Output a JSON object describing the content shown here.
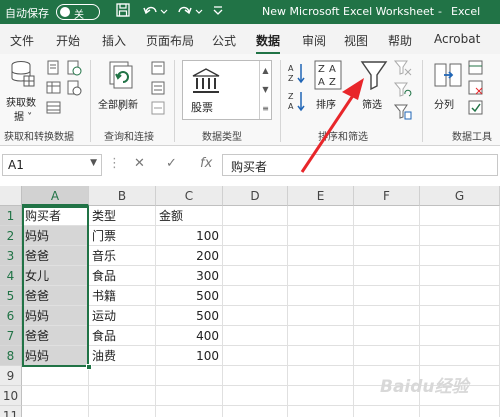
{
  "titlebar": {
    "autosave_label": "自动保存",
    "autosave_state": "关",
    "doc_title": "New Microsoft Excel Worksheet",
    "separator": "-",
    "app_name": "Excel"
  },
  "ribbon_tabs": [
    "文件",
    "开始",
    "插入",
    "页面布局",
    "公式",
    "数据",
    "审阅",
    "视图",
    "帮助",
    "Acrobat"
  ],
  "active_tab": "数据",
  "ribbon": {
    "get_data_label": "获取数\n据",
    "get_data_label_line1": "获取数",
    "get_data_label_line2": "据 ˅",
    "group_get_transform": "获取和转换数据",
    "refresh_all_label": "全部刷新",
    "refresh_all_dd": "˅",
    "group_query": "查询和连接",
    "stock_label": "股票",
    "group_data_types": "数据类型",
    "sort_label": "排序",
    "filter_label": "筛选",
    "group_sort_filter": "排序和筛选",
    "split_label": "分列",
    "group_data_tools": "数据工具"
  },
  "formula_bar": {
    "name_box": "A1",
    "cancel_icon": "✕",
    "enter_icon": "✓",
    "fx_label": "fx",
    "formula": "购买者"
  },
  "grid": {
    "columns": [
      "A",
      "B",
      "C",
      "D",
      "E",
      "F",
      "G"
    ],
    "rows": [
      "1",
      "2",
      "3",
      "4",
      "5",
      "6",
      "7",
      "8",
      "9",
      "10",
      "11"
    ],
    "data": [
      [
        "购买者",
        "类型",
        "金额"
      ],
      [
        "妈妈",
        "门票",
        "100"
      ],
      [
        "爸爸",
        "音乐",
        "200"
      ],
      [
        "女儿",
        "食品",
        "300"
      ],
      [
        "爸爸",
        "书籍",
        "500"
      ],
      [
        "妈妈",
        "运动",
        "500"
      ],
      [
        "爸爸",
        "食品",
        "400"
      ],
      [
        "妈妈",
        "油费",
        "100"
      ]
    ]
  },
  "watermark": "Baidu经验",
  "colors": {
    "excel_green": "#217346",
    "arrow_red": "#e8262a"
  }
}
